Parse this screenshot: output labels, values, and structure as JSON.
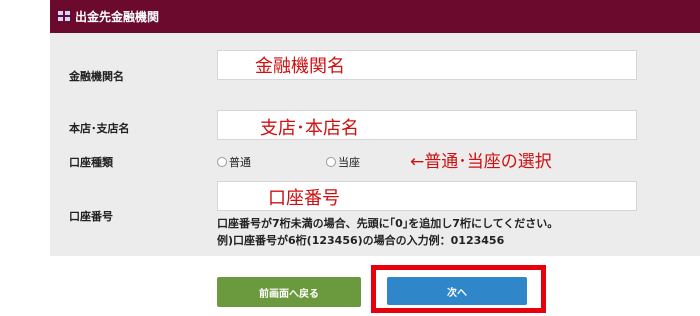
{
  "header": {
    "title": "出金先金融機関",
    "icon": "grid-icon"
  },
  "form": {
    "bank_name": {
      "label": "金融機関名",
      "annotation": "金融機関名"
    },
    "branch_name": {
      "label": "本店･支店名",
      "annotation": "支店･本店名"
    },
    "account_type": {
      "label": "口座種類",
      "options": [
        "普通",
        "当座"
      ],
      "annotation": "←普通･当座の選択"
    },
    "account_number": {
      "label": "口座番号",
      "annotation": "口座番号",
      "note_line1": "口座番号が7桁未満の場合、先頭に｢0｣を追加し7桁にしてください。",
      "note_line2": "例)口座番号が6桁(123456)の場合の入力例：0123456"
    }
  },
  "buttons": {
    "back": "前画面へ戻る",
    "next": "次へ"
  },
  "colors": {
    "header": "#6b0a2c",
    "back_button": "#6b9a3e",
    "next_button": "#2f86c8",
    "annotation": "#d01010",
    "highlight": "#e8000c"
  }
}
